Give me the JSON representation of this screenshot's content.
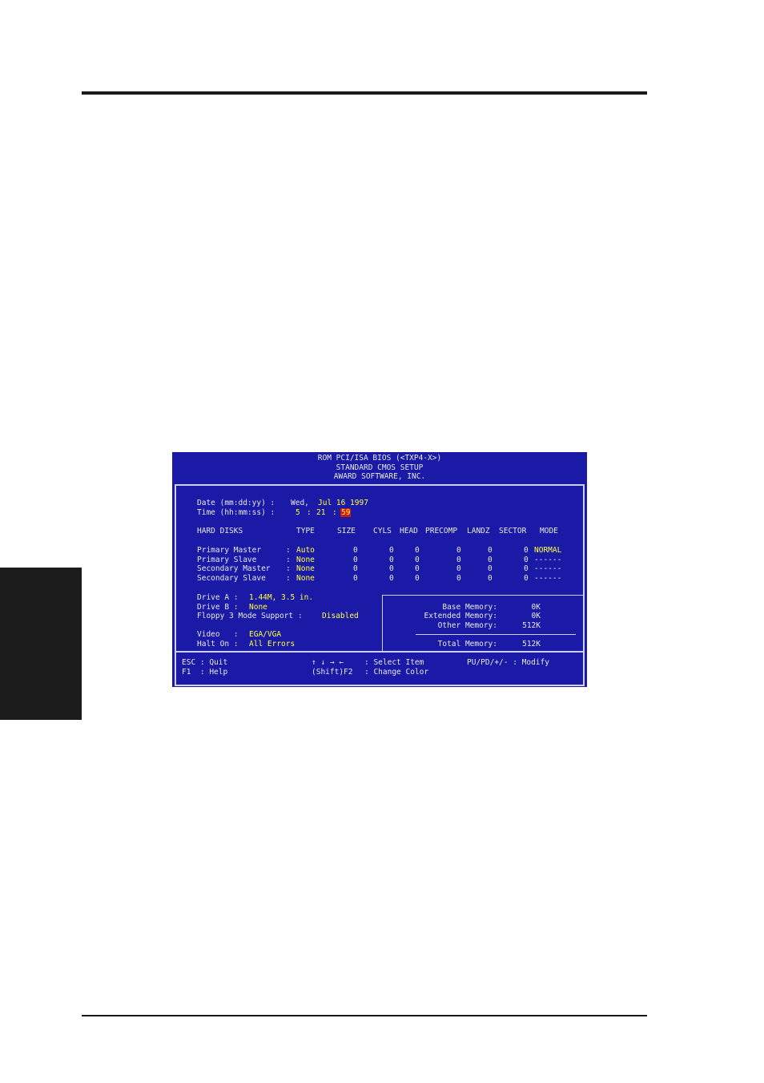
{
  "header": {
    "line1": "ROM PCI/ISA BIOS (<TXP4-X>)",
    "line2": "STANDARD CMOS SETUP",
    "line3": "AWARD SOFTWARE, INC."
  },
  "date": {
    "label": "Date (mm:dd:yy) :",
    "weekday": "Wed,",
    "value": "Jul 16 1997"
  },
  "time": {
    "label": "Time (hh:mm:ss) :",
    "hour": "5",
    "sep1": ":",
    "minute": "21",
    "sep2": ":",
    "second": "59"
  },
  "hard_disks": {
    "columns": [
      "HARD DISKS",
      "TYPE",
      "SIZE",
      "CYLS",
      "HEAD",
      "PRECOMP",
      "LANDZ",
      "SECTOR",
      "MODE"
    ],
    "rows": [
      {
        "name": "Primary Master",
        "type": "Auto",
        "size": "0",
        "cyls": "0",
        "head": "0",
        "precomp": "0",
        "landz": "0",
        "sector": "0",
        "mode": "NORMAL"
      },
      {
        "name": "Primary Slave",
        "type": "None",
        "size": "0",
        "cyls": "0",
        "head": "0",
        "precomp": "0",
        "landz": "0",
        "sector": "0",
        "mode": "------"
      },
      {
        "name": "Secondary Master",
        "type": "None",
        "size": "0",
        "cyls": "0",
        "head": "0",
        "precomp": "0",
        "landz": "0",
        "sector": "0",
        "mode": "------"
      },
      {
        "name": "Secondary Slave",
        "type": "None",
        "size": "0",
        "cyls": "0",
        "head": "0",
        "precomp": "0",
        "landz": "0",
        "sector": "0",
        "mode": "------"
      }
    ]
  },
  "drives": {
    "drive_a_label": "Drive A :",
    "drive_a_value": "1.44M, 3.5 in.",
    "drive_b_label": "Drive B :",
    "drive_b_value": "None",
    "floppy_label": "Floppy 3 Mode Support :",
    "floppy_value": "Disabled"
  },
  "video": {
    "label": "Video   :",
    "value": "EGA/VGA"
  },
  "halt_on": {
    "label": "Halt On :",
    "value": "All Errors"
  },
  "memory": {
    "base_label": "Base Memory:",
    "base_value": "0K",
    "extended_label": "Extended Memory:",
    "extended_value": "0K",
    "other_label": "Other Memory:",
    "other_value": "512K",
    "total_label": "Total Memory:",
    "total_value": "512K"
  },
  "footer": {
    "esc": "ESC : Quit",
    "f1": "F1  : Help",
    "arrows": "↑ ↓ → ←",
    "select": ": Select Item",
    "shift_f2": "(Shift)F2",
    "change_color": ": Change Color",
    "modify": "PU/PD/+/- : Modify"
  }
}
